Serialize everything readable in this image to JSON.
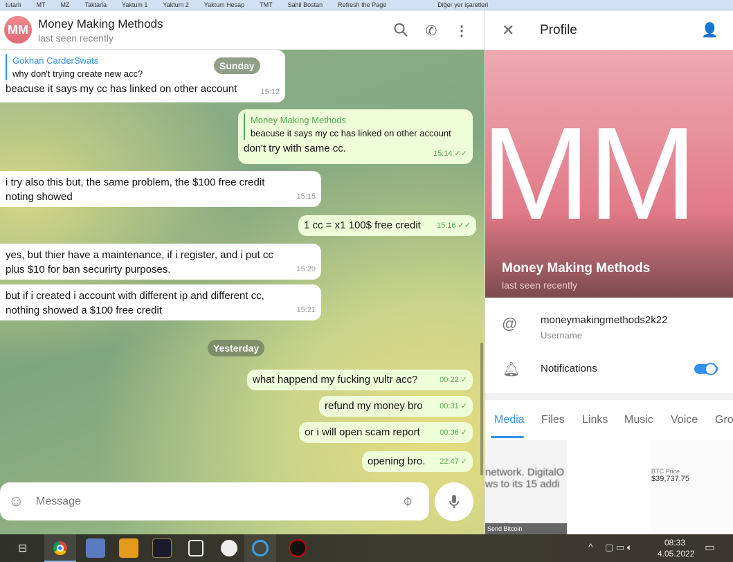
{
  "bookmarks": [
    "tutarlı",
    "MT",
    "MZ",
    "Taktarla",
    "Yaktum 1",
    "Yaktum 2",
    "Yaktum Hesap",
    "TMT",
    "Sahil Bostan",
    "Refresh the Page",
    "Diğer yer işaretleri"
  ],
  "chat": {
    "avatar_initials": "MM",
    "title": "Money Making Methods",
    "status": "last seen recently",
    "messages": [
      {
        "dir": "in",
        "reply_name": "Gokhan CarderSwats",
        "reply_text": "why don't trying create new acc?",
        "text": "beacuse it says my cc has linked on other account",
        "time": "15:12"
      },
      {
        "dir": "out",
        "reply_name": "Money Making Methods",
        "reply_text": "beacuse it says my cc has linked on other account",
        "text": "don't try with same cc.",
        "time": "15:14"
      },
      {
        "dir": "in",
        "text": "i try also this but, the same problem, the $100 free credit noting showed",
        "time": "15:15"
      },
      {
        "dir": "out",
        "text": "1 cc = x1 100$ free credit",
        "time": "15:16"
      },
      {
        "dir": "in",
        "text": "yes, but thier have a maintenance, if i register, and i put cc plus $10 for ban securirty purposes.",
        "time": "15:20"
      },
      {
        "dir": "in",
        "text": "but if i created i account with different ip and different cc, nothing showed a $100 free credit",
        "time": "15:21"
      },
      {
        "dir": "out",
        "text": "what happend my fucking vultr acc?",
        "time": "00:22"
      },
      {
        "dir": "out",
        "text": "refund my money bro",
        "time": "00:31"
      },
      {
        "dir": "out",
        "text": "or i will open scam report",
        "time": "00:36"
      },
      {
        "dir": "out",
        "text": "opening bro.",
        "time": "22:47"
      }
    ],
    "date_sunday": "Sunday",
    "date_yesterday": "Yesterday",
    "input_placeholder": "Message"
  },
  "profile": {
    "title": "Profile",
    "name": "Money Making Methods",
    "status": "last seen recently",
    "photo_initials": "MM",
    "username": "moneymakingmethods2k22",
    "username_label": "Username",
    "notifications_label": "Notifications",
    "notifications_on": true,
    "tabs": [
      "Media",
      "Files",
      "Links",
      "Music",
      "Voice",
      "Gro"
    ],
    "active_tab": "Media",
    "thumb_texts": [
      "network. DigitalO",
      "ws to its 15 addi",
      "BTC Price",
      "$39,737.75",
      "Send Bitcoin"
    ]
  },
  "taskbar": {
    "time": "08:33",
    "date": "4.05.2022",
    "icons": [
      "task-view",
      "chrome",
      "network-app",
      "dreamweaver",
      "app-r",
      "windows-app",
      "md5",
      "app-s",
      "app-red"
    ]
  },
  "colors": {
    "accent": "#3390ec",
    "outgoing": "#eefed9",
    "check": "#4fae4e"
  }
}
